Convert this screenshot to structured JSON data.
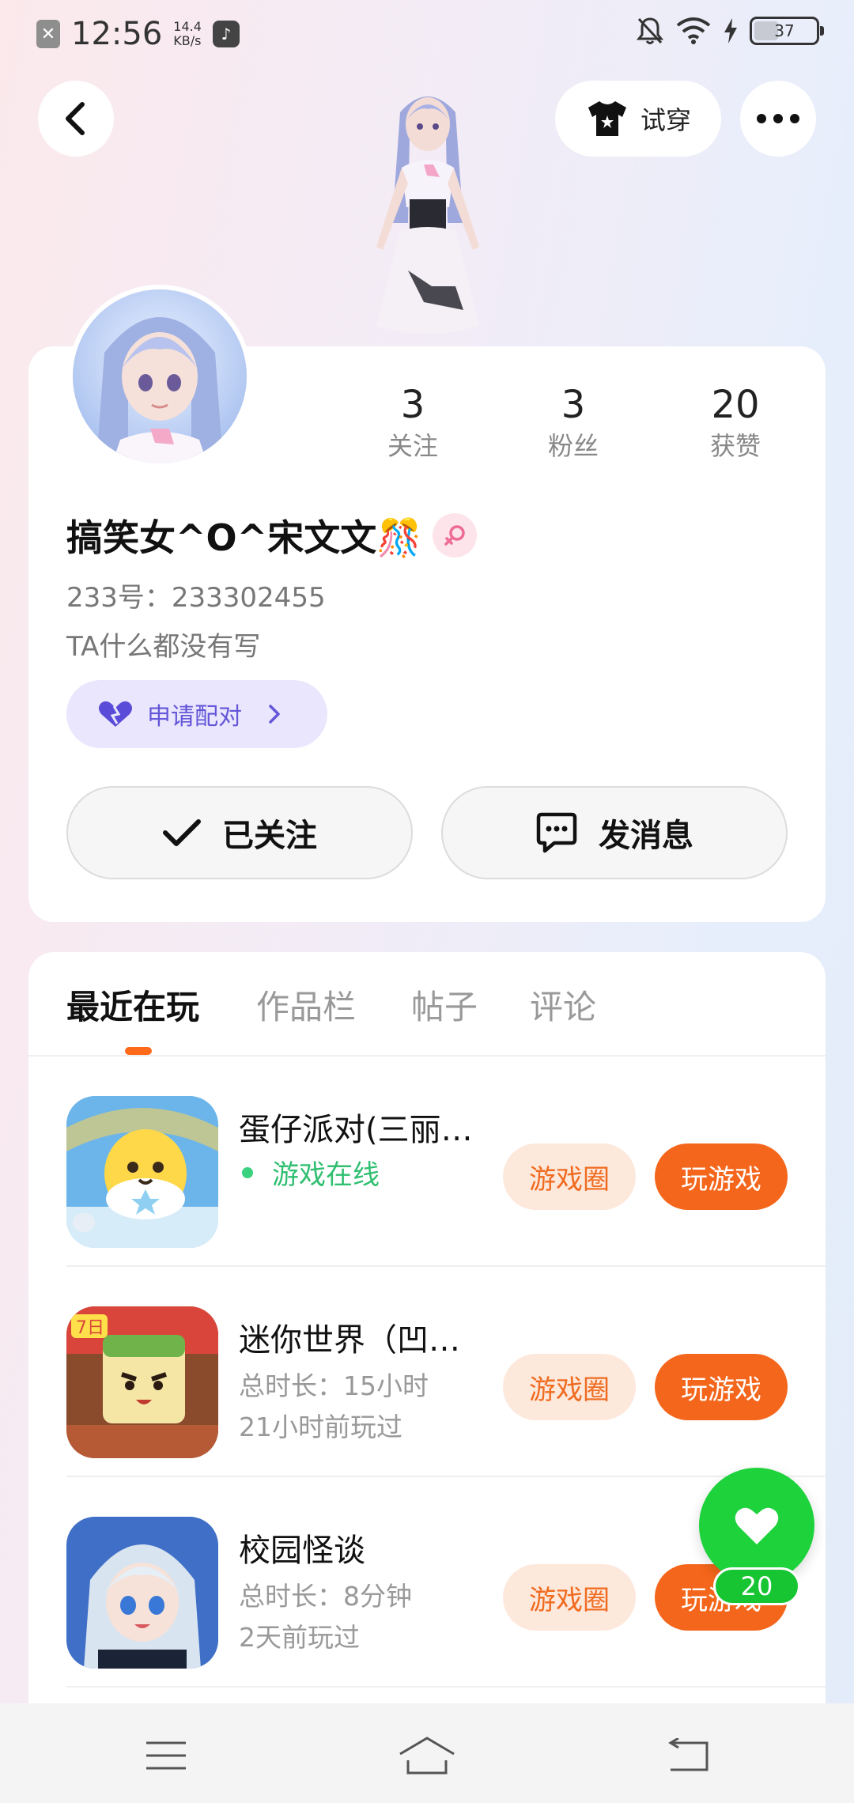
{
  "status_bar": {
    "time": "12:56",
    "net_speed_value": "14.4",
    "net_speed_unit": "KB/s",
    "battery": "37"
  },
  "header": {
    "tryon_label": "试穿"
  },
  "profile": {
    "stats": [
      {
        "value": "3",
        "label": "关注"
      },
      {
        "value": "3",
        "label": "粉丝"
      },
      {
        "value": "20",
        "label": "获赞"
      }
    ],
    "name": "搞笑女^O^宋文文🎊",
    "uid": "233号：233302455",
    "bio": "TA什么都没有写",
    "pair_label": "申请配对",
    "follow_label": "已关注",
    "message_label": "发消息"
  },
  "tabs": [
    {
      "label": "最近在玩",
      "active": true
    },
    {
      "label": "作品栏",
      "active": false
    },
    {
      "label": "帖子",
      "active": false
    },
    {
      "label": "评论",
      "active": false
    }
  ],
  "games": [
    {
      "title": "蛋仔派对(三丽…",
      "status": "游戏在线",
      "circle_label": "游戏圈",
      "play_label": "玩游戏"
    },
    {
      "title": "迷你世界（凹…",
      "duration": "总时长：15小时",
      "last_played": "21小时前玩过",
      "circle_label": "游戏圈",
      "play_label": "玩游戏"
    },
    {
      "title": "校园怪谈",
      "duration": "总时长：8分钟",
      "last_played": "2天前玩过",
      "circle_label": "游戏圈",
      "play_label": "玩游戏"
    }
  ],
  "fab": {
    "like_count": "20"
  },
  "colors": {
    "accent": "#f4661b",
    "online": "#2fbf71",
    "like": "#1ed23c",
    "pair": "#6456d8"
  }
}
